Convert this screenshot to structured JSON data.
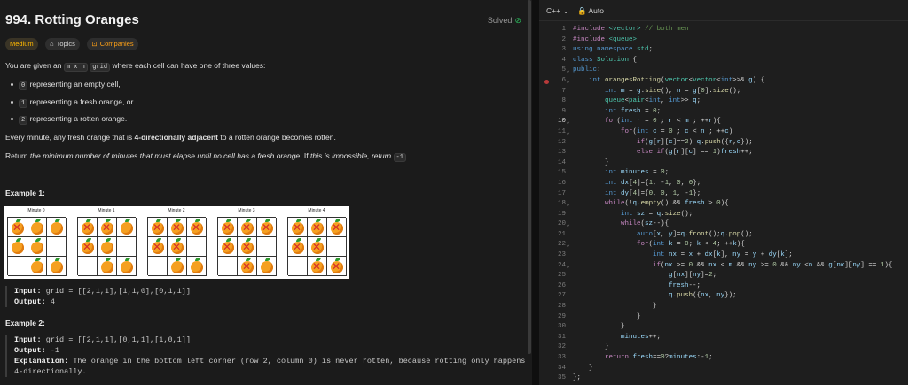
{
  "problem": {
    "title": "994. Rotting Oranges",
    "status": "Solved",
    "tags": {
      "difficulty": "Medium",
      "topics": "Topics",
      "companies": "Companies"
    },
    "intro_1": "You are given an",
    "intro_code": "m x n",
    "intro_code2": "grid",
    "intro_2": "where each cell can have one of three values:",
    "bullets": [
      {
        "code": "0",
        "text": "representing an empty cell,"
      },
      {
        "code": "1",
        "text": "representing a fresh orange, or"
      },
      {
        "code": "2",
        "text": "representing a rotten orange."
      }
    ],
    "rule_1": "Every minute, any fresh orange that is",
    "rule_bold": "4-directionally adjacent",
    "rule_2": "to a rotten orange becomes rotten.",
    "return_1": "Return",
    "return_italic": "the minimum number of minutes that must elapse until no cell has a fresh orange",
    "return_2": ". If",
    "return_italic2": "this is impossible, return",
    "return_code": "-1",
    "return_end": "."
  },
  "example1": {
    "heading": "Example 1:",
    "minutes": [
      "Minute 0",
      "Minute 1",
      "Minute 2",
      "Minute 3",
      "Minute 4"
    ],
    "input_label": "Input:",
    "input_value": "grid = [[2,1,1],[1,1,0],[0,1,1]]",
    "output_label": "Output:",
    "output_value": "4"
  },
  "example2": {
    "heading": "Example 2:",
    "input_label": "Input:",
    "input_value": "grid = [[2,1,1],[0,1,1],[1,0,1]]",
    "output_label": "Output:",
    "output_value": "-1",
    "explanation_label": "Explanation:",
    "explanation_1": "The orange in the bottom left corner (row 2, column 0) is never rotten, because rotting only happens",
    "explanation_2": "4-directionally."
  },
  "editor": {
    "language": "C++",
    "mode": "Auto",
    "active_line": 10,
    "breakpoint_line": 6
  }
}
